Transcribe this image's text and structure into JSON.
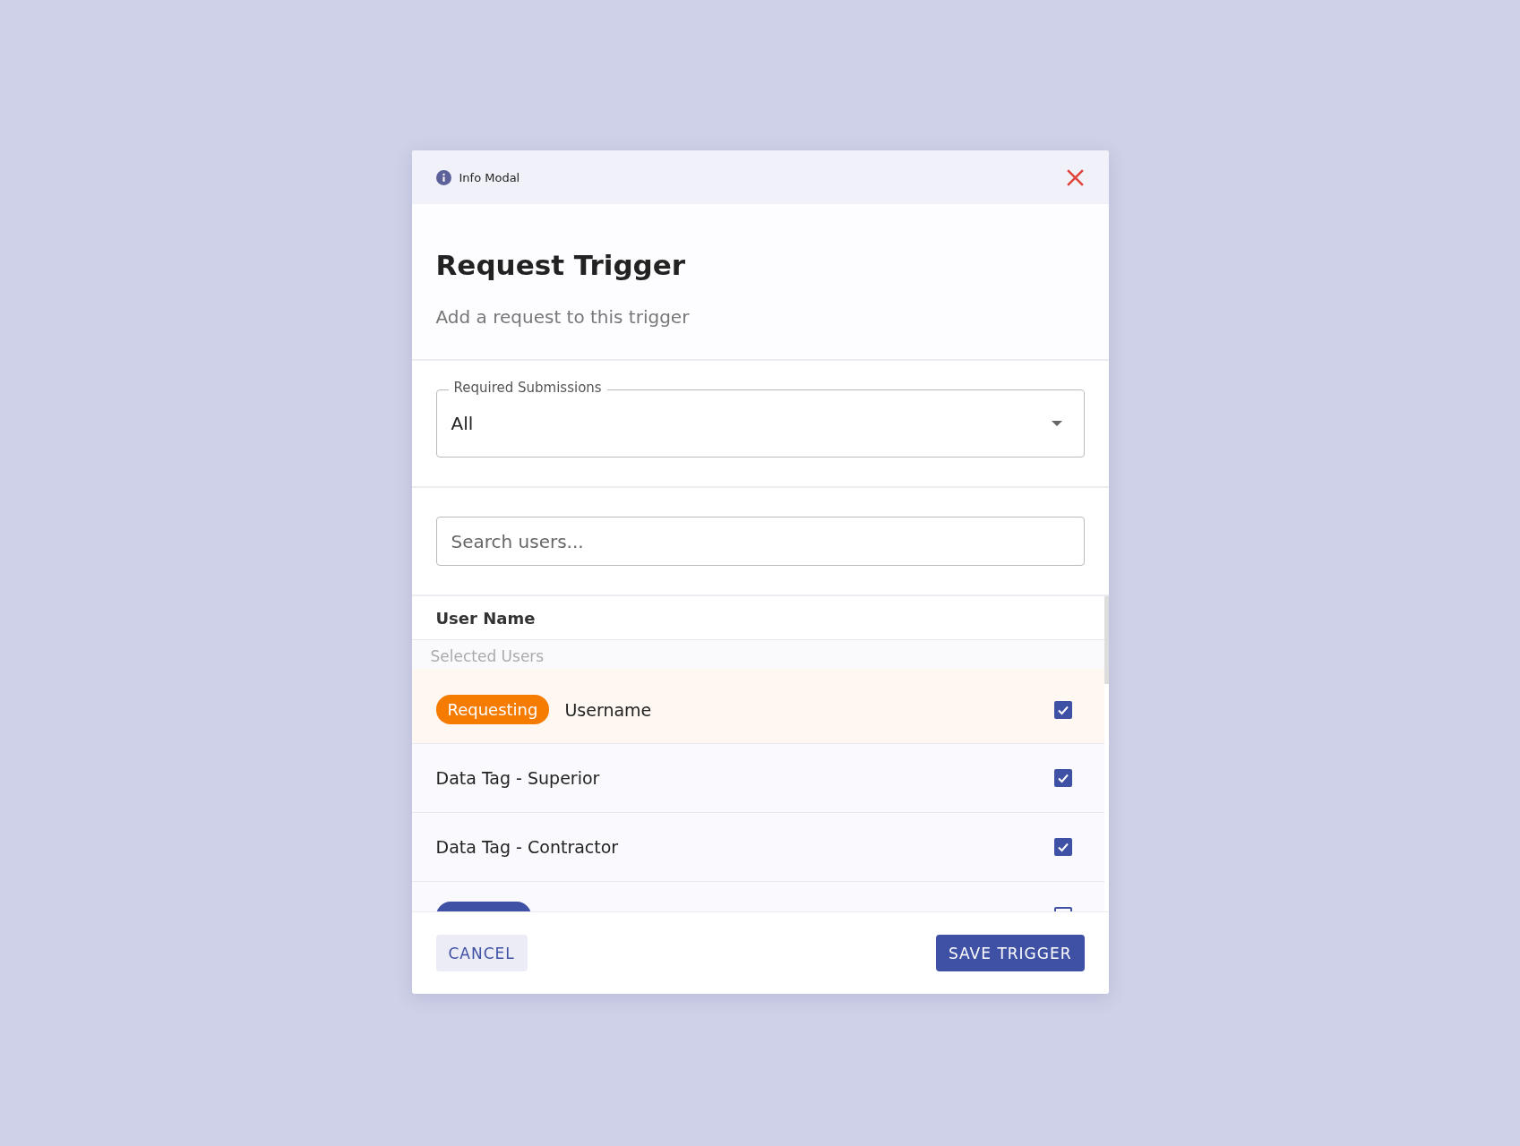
{
  "modal": {
    "header": "Info Modal",
    "title": "Request Trigger",
    "subtitle": "Add a request to this trigger"
  },
  "select": {
    "label": "Required Submissions",
    "value": "All"
  },
  "search": {
    "placeholder": "Search users..."
  },
  "table": {
    "column": "User Name",
    "group": "Selected Users",
    "rows": [
      {
        "badge": {
          "label": "Requesting",
          "color": "#f57c00"
        },
        "label": "Username",
        "checked": true,
        "highlighted": true
      },
      {
        "label": "Data Tag - Superior",
        "checked": true,
        "highlighted": false
      },
      {
        "label": "Data Tag - Contractor",
        "checked": true,
        "highlighted": false
      },
      {
        "badge": {
          "color": "#3f51a5"
        },
        "highlighted": false
      }
    ]
  },
  "buttons": [
    {
      "kind": "secondary",
      "label": "CANCEL"
    },
    {
      "kind": "primary",
      "label": "SAVE TRIGGER"
    }
  ]
}
